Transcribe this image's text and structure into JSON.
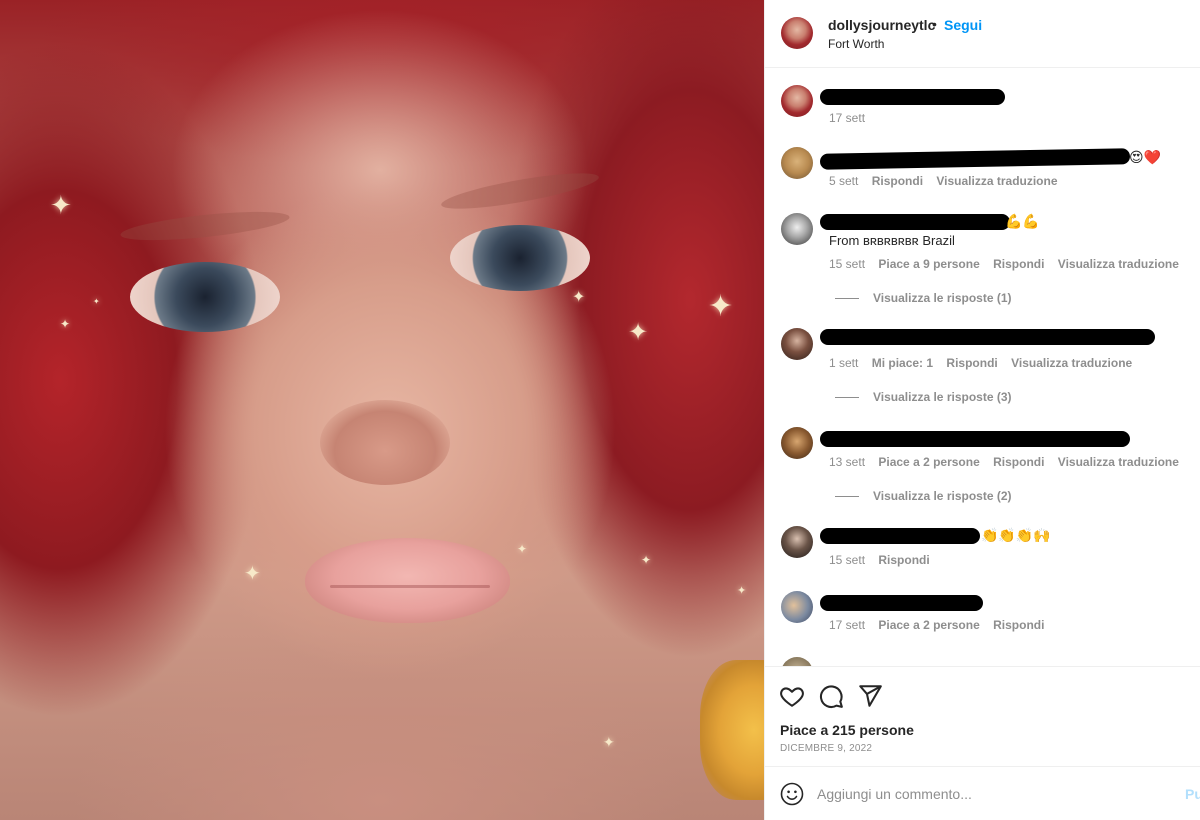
{
  "photo": {
    "alt_icons": [
      "sparkle-icon"
    ]
  },
  "header": {
    "username": "dollysjourneytlc",
    "separator": "•",
    "follow_label": "Segui",
    "location": "Fort Worth"
  },
  "comments": [
    {
      "text": "",
      "emoji": "",
      "meta": [
        "17 sett"
      ],
      "replies": ""
    },
    {
      "text": "",
      "emoji": "😍❤️",
      "meta": [
        "5 sett",
        "Rispondi",
        "Visualizza traduzione"
      ],
      "replies": ""
    },
    {
      "text": "From ʙʀʙʀʙʀʙʀ Brazil",
      "emoji": "💪💪",
      "meta": [
        "15 sett",
        "Piace a 9 persone",
        "Rispondi",
        "Visualizza traduzione"
      ],
      "replies": "Visualizza le risposte (1)"
    },
    {
      "text": "",
      "emoji": "",
      "meta": [
        "1 sett",
        "Mi piace: 1",
        "Rispondi",
        "Visualizza traduzione"
      ],
      "replies": "Visualizza le risposte (3)"
    },
    {
      "text": "",
      "emoji": "",
      "meta": [
        "13 sett",
        "Piace a 2 persone",
        "Rispondi",
        "Visualizza traduzione"
      ],
      "replies": "Visualizza le risposte (2)"
    },
    {
      "text": "",
      "emoji": "👏👏👏🙌",
      "meta": [
        "15 sett",
        "Rispondi"
      ],
      "replies": ""
    },
    {
      "text": "",
      "emoji": "",
      "meta": [
        "17 sett",
        "Piace a 2 persone",
        "Rispondi"
      ],
      "replies": ""
    }
  ],
  "actions": {
    "like_icon": "heart-icon",
    "comment_icon": "comment-bubble-icon",
    "share_icon": "paper-plane-icon",
    "likes_text": "Piace a 215 persone",
    "date": "DICEMBRE 9, 2022"
  },
  "add_comment": {
    "placeholder": "Aggiungi un commento...",
    "post_label": "Pu"
  },
  "colors": {
    "link_blue": "#0095f6",
    "muted_gray": "#8e8e8e",
    "text_dark": "#262626",
    "post_disabled": "#b2dffc"
  }
}
